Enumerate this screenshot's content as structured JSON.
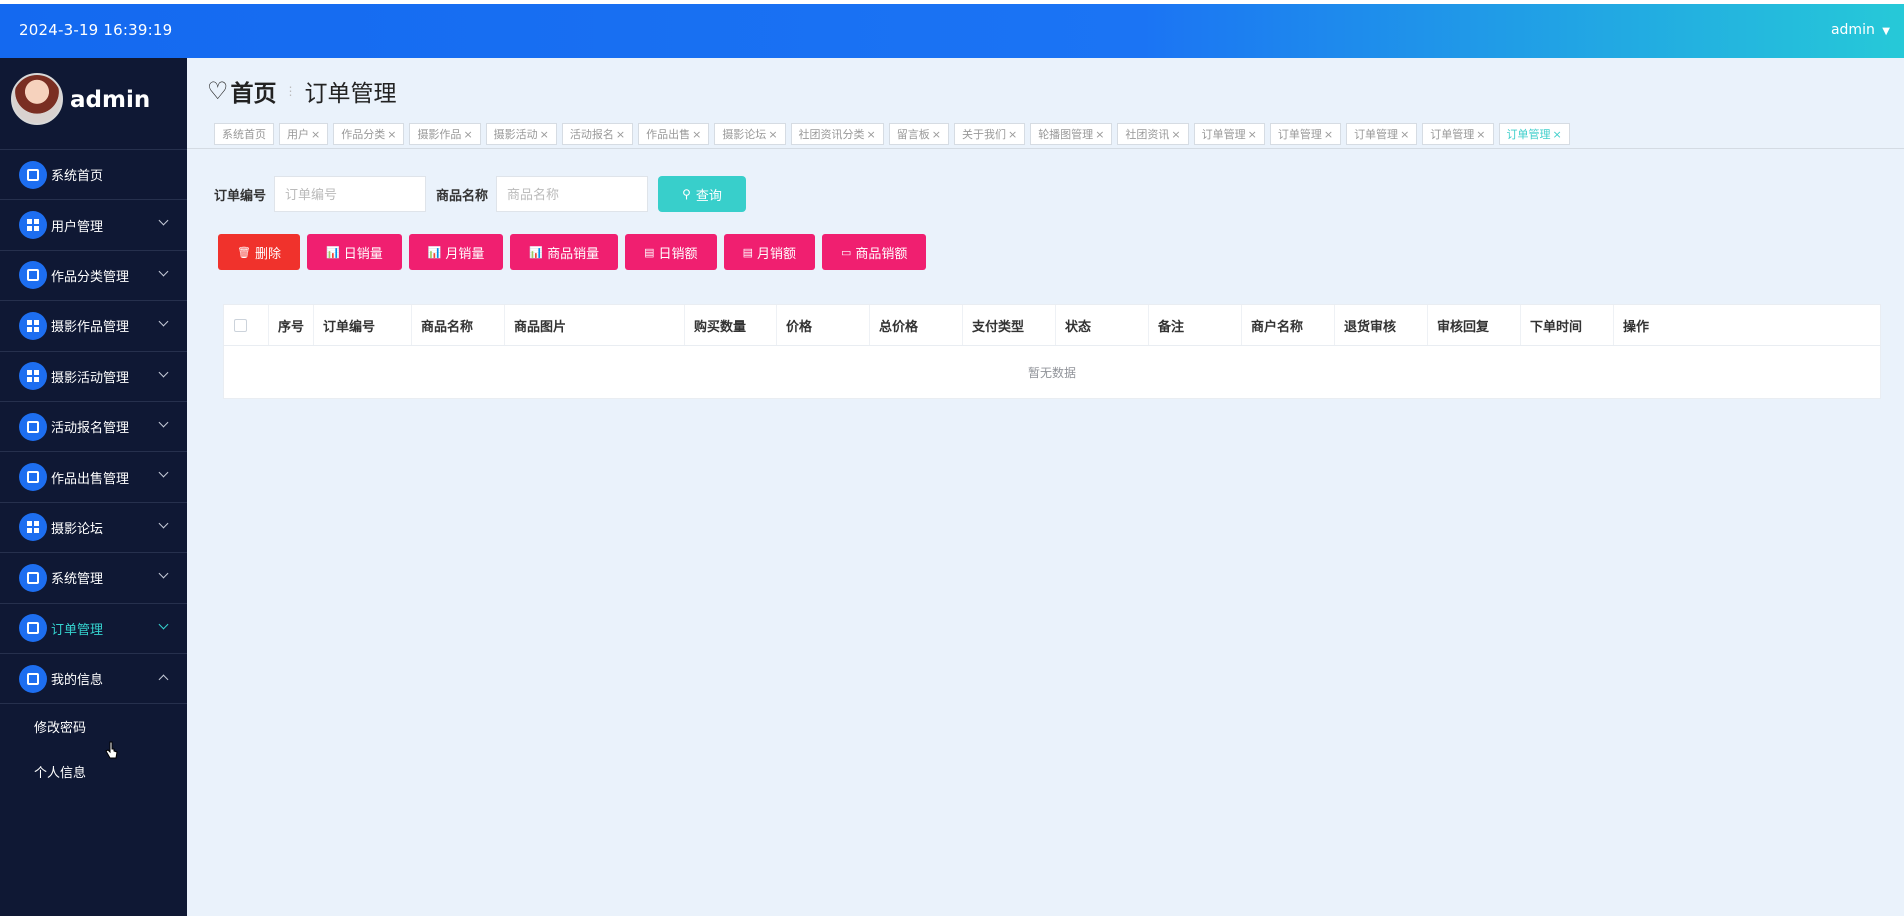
{
  "header": {
    "datetime": "2024-3-19 16:39:19",
    "user": "admin"
  },
  "sidebar": {
    "username": "admin",
    "items": [
      {
        "label": "系统首页",
        "icon": "home-icon",
        "expandable": false
      },
      {
        "label": "用户管理",
        "icon": "grid-icon",
        "expandable": true
      },
      {
        "label": "作品分类管理",
        "icon": "folder-icon",
        "expandable": true
      },
      {
        "label": "摄影作品管理",
        "icon": "grid-icon",
        "expandable": true
      },
      {
        "label": "摄影活动管理",
        "icon": "grid-icon",
        "expandable": true
      },
      {
        "label": "活动报名管理",
        "icon": "clipboard-icon",
        "expandable": true
      },
      {
        "label": "作品出售管理",
        "icon": "briefcase-icon",
        "expandable": true
      },
      {
        "label": "摄影论坛",
        "icon": "grid-icon",
        "expandable": true
      },
      {
        "label": "系统管理",
        "icon": "chat-icon",
        "expandable": true
      },
      {
        "label": "订单管理",
        "icon": "user-icon",
        "expandable": true,
        "active": true
      },
      {
        "label": "我的信息",
        "icon": "card-icon",
        "expandable": true,
        "expanded": true
      }
    ],
    "submenu": [
      {
        "label": "修改密码"
      },
      {
        "label": "个人信息"
      }
    ]
  },
  "breadcrumb": {
    "home": "首页",
    "current": "订单管理"
  },
  "tags": [
    {
      "label": "系统首页",
      "closable": false
    },
    {
      "label": "用户",
      "closable": true
    },
    {
      "label": "作品分类",
      "closable": true
    },
    {
      "label": "摄影作品",
      "closable": true
    },
    {
      "label": "摄影活动",
      "closable": true
    },
    {
      "label": "活动报名",
      "closable": true
    },
    {
      "label": "作品出售",
      "closable": true
    },
    {
      "label": "摄影论坛",
      "closable": true
    },
    {
      "label": "社团资讯分类",
      "closable": true
    },
    {
      "label": "留言板",
      "closable": true
    },
    {
      "label": "关于我们",
      "closable": true
    },
    {
      "label": "轮播图管理",
      "closable": true
    },
    {
      "label": "社团资讯",
      "closable": true
    },
    {
      "label": "订单管理",
      "closable": true
    },
    {
      "label": "订单管理",
      "closable": true
    },
    {
      "label": "订单管理",
      "closable": true
    },
    {
      "label": "订单管理",
      "closable": true
    },
    {
      "label": "订单管理",
      "closable": true,
      "active": true
    }
  ],
  "search": {
    "order_no_label": "订单编号",
    "order_no_placeholder": "订单编号",
    "product_label": "商品名称",
    "product_placeholder": "商品名称",
    "query_label": "查询"
  },
  "actions": [
    {
      "label": "删除",
      "style": "red",
      "icon": "🗑"
    },
    {
      "label": "日销量",
      "style": "pink",
      "icon": "📊"
    },
    {
      "label": "月销量",
      "style": "pink",
      "icon": "📊"
    },
    {
      "label": "商品销量",
      "style": "pink",
      "icon": "📊"
    },
    {
      "label": "日销额",
      "style": "pink",
      "icon": "▤"
    },
    {
      "label": "月销额",
      "style": "pink",
      "icon": "▤"
    },
    {
      "label": "商品销额",
      "style": "pink",
      "icon": "▭"
    }
  ],
  "table": {
    "columns": [
      "序号",
      "订单编号",
      "商品名称",
      "商品图片",
      "购买数量",
      "价格",
      "总价格",
      "支付类型",
      "状态",
      "备注",
      "商户名称",
      "退货审核",
      "审核回复",
      "下单时间",
      "操作"
    ],
    "empty_text": "暂无数据"
  }
}
